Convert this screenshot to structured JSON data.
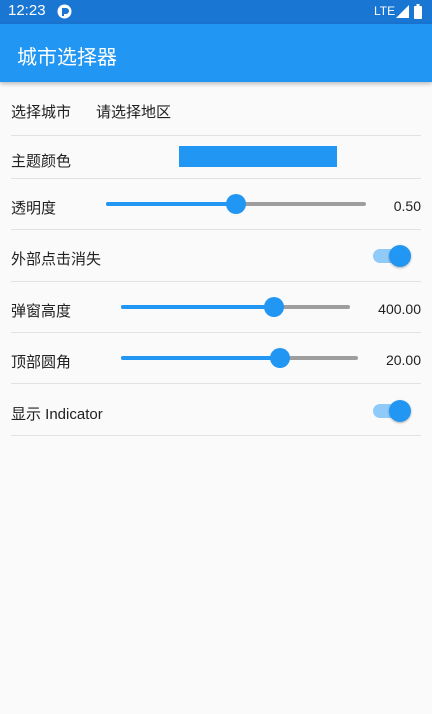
{
  "status_bar": {
    "time": "12:23",
    "network": "LTE"
  },
  "app_bar": {
    "title": "城市选择器"
  },
  "settings": {
    "city": {
      "label": "选择城市",
      "value": "请选择地区"
    },
    "theme_color": {
      "label": "主题颜色",
      "color": "#2196f3"
    },
    "opacity": {
      "label": "透明度",
      "value_text": "0.50",
      "fraction": 0.5
    },
    "dismiss_on_outside_tap": {
      "label": "外部点击消失",
      "on": true
    },
    "popup_height": {
      "label": "弹窗高度",
      "value_text": "400.00",
      "fraction": 0.67
    },
    "top_radius": {
      "label": "顶部圆角",
      "value_text": "20.00",
      "fraction": 0.67
    },
    "show_indicator": {
      "label": "显示 Indicator",
      "on": true
    }
  },
  "colors": {
    "accent": "#2196f3",
    "status_bar": "#1976d2",
    "background": "#fafafa"
  }
}
